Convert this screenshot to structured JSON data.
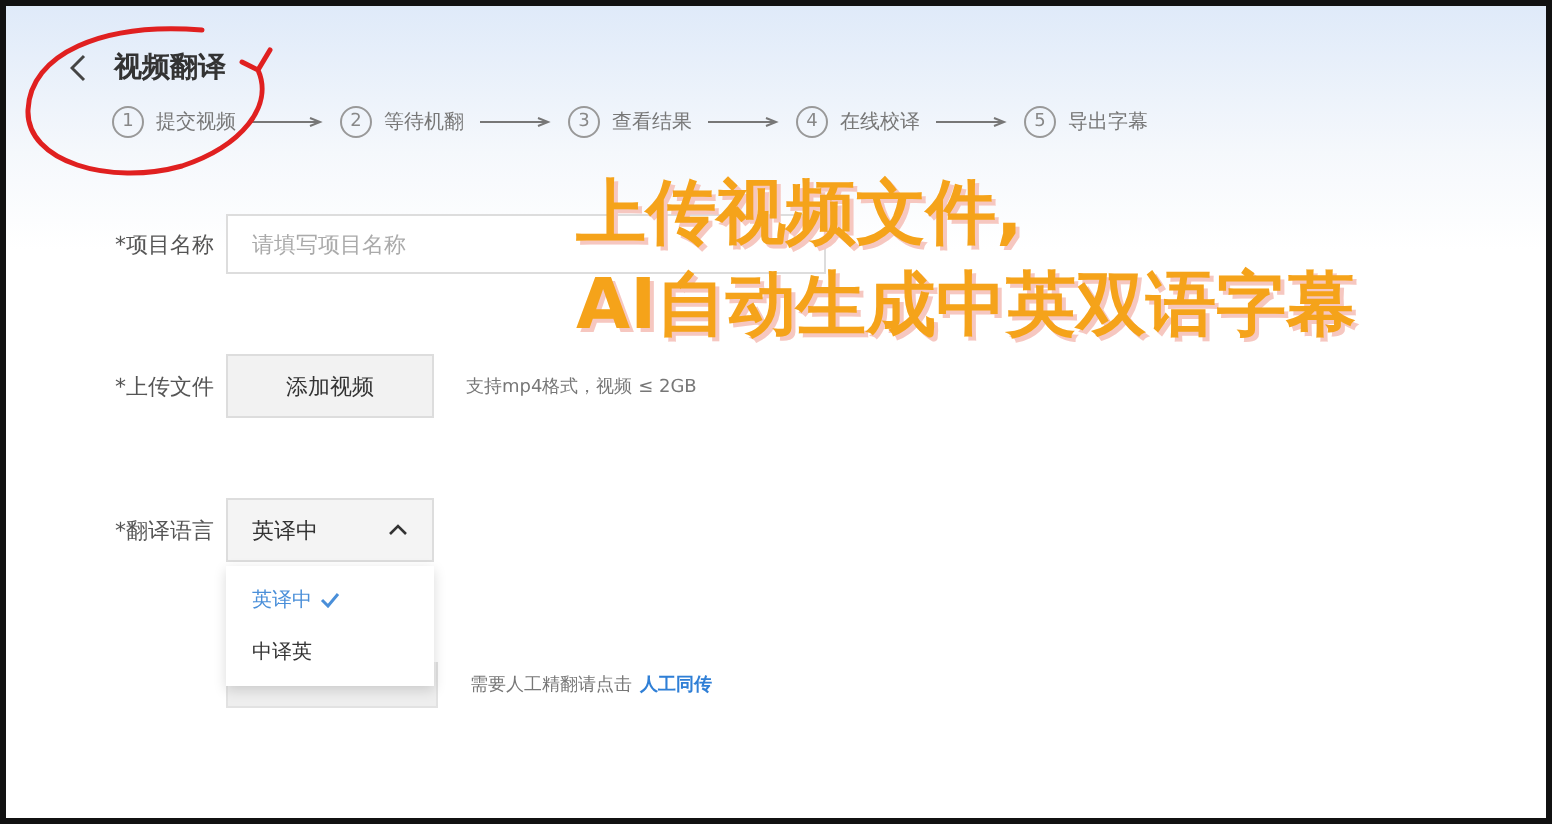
{
  "header": {
    "title": "视频翻译"
  },
  "steps": [
    {
      "number": "1",
      "label": "提交视频"
    },
    {
      "number": "2",
      "label": "等待机翻"
    },
    {
      "number": "3",
      "label": "查看结果"
    },
    {
      "number": "4",
      "label": "在线校译"
    },
    {
      "number": "5",
      "label": "导出字幕"
    }
  ],
  "form": {
    "name_label": "*项目名称",
    "name_placeholder": "请填写项目名称",
    "upload_label": "*上传文件",
    "upload_button": "添加视频",
    "upload_hint": "支持mp4格式，视频 ≤ 2GB",
    "language_label": "*翻译语言",
    "language_value": "英译中",
    "language_options": [
      {
        "label": "英译中",
        "selected": true
      },
      {
        "label": "中译英",
        "selected": false
      }
    ],
    "manual_hint": "需要人工精翻请点击",
    "manual_link": "人工同传"
  },
  "caption": [
    "上传视频文件,",
    "AI自动生成中英双语字幕"
  ]
}
